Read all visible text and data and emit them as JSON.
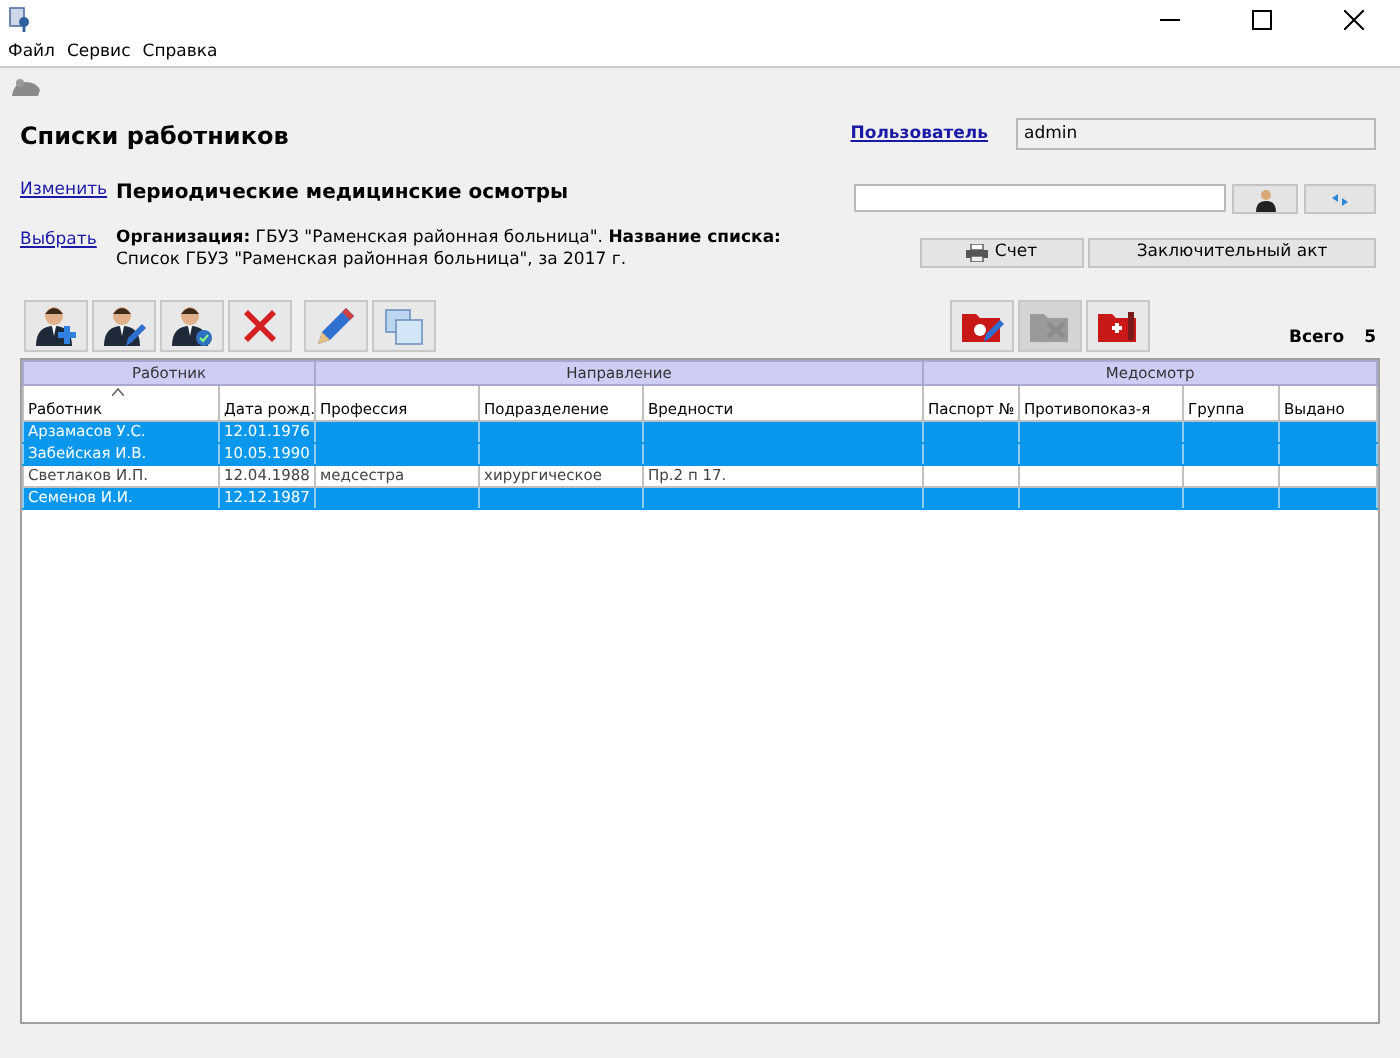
{
  "menu": [
    {
      "label": "Файл"
    },
    {
      "label": "Сервис"
    },
    {
      "label": "Справка"
    }
  ],
  "title": "Списки работников",
  "links": [
    {
      "label": "Изменить",
      "text": "Периодические медицинские осмотры",
      "kind": "heading"
    },
    {
      "label": "Выбрать",
      "text": "**Организация:** ГБУЗ \"Раменская районная больница\". **Название списка:** Список ГБУЗ \"Раменская районная больница\", за 2017 г.",
      "kind": "details"
    }
  ],
  "user": {
    "label": "Пользователь",
    "value": "admin"
  },
  "search": {
    "buttons": [
      {
        "kind": "person"
      },
      {
        "kind": "refresh"
      }
    ]
  },
  "actions": [
    {
      "label": "Счет",
      "kind": "printer"
    },
    {
      "label": "Заключительный акт",
      "kind": "plain"
    }
  ],
  "toolbar_left": [
    {
      "kind": "add-person",
      "disabled": false
    },
    {
      "kind": "edit-person",
      "disabled": false
    },
    {
      "kind": "check-person",
      "disabled": false
    },
    {
      "kind": "delete",
      "disabled": false
    },
    {
      "kind": "pencil",
      "disabled": false
    },
    {
      "kind": "copy",
      "disabled": false
    }
  ],
  "toolbar_right": [
    {
      "kind": "folder-pen",
      "disabled": false
    },
    {
      "kind": "folder-x",
      "disabled": true
    },
    {
      "kind": "folder-medical",
      "disabled": false
    }
  ],
  "total": {
    "label": "Всего",
    "value": "5"
  },
  "table": {
    "groups": [
      {
        "label": "Работник",
        "columns": [
          {
            "label": "Работник",
            "sorted": true
          },
          {
            "label": "Дата рожд.",
            "sorted": false
          }
        ]
      },
      {
        "label": "Направление",
        "columns": [
          {
            "label": "Профессия",
            "sorted": false
          },
          {
            "label": "Подразделение",
            "sorted": false
          },
          {
            "label": "Вредности",
            "sorted": false
          }
        ]
      },
      {
        "label": "Медосмотр",
        "columns": [
          {
            "label": "Паспорт №",
            "sorted": false
          },
          {
            "label": "Противопоказ-я",
            "sorted": false
          },
          {
            "label": "Группа",
            "sorted": false
          },
          {
            "label": "Выдано",
            "sorted": false
          }
        ]
      }
    ],
    "rows": [
      {
        "selected": true,
        "cells": [
          "Арзамасов У.С.",
          "12.01.1976",
          null,
          null,
          null,
          null,
          null,
          null,
          null
        ]
      },
      {
        "selected": true,
        "cells": [
          "Забейская И.В.",
          "10.05.1990",
          null,
          null,
          null,
          null,
          null,
          null,
          null
        ]
      },
      {
        "selected": false,
        "cells": [
          "Светлаков И.П.",
          "12.04.1988",
          "медсестра",
          "хирургическое",
          "Пр.2 п 17.",
          null,
          null,
          null,
          null
        ]
      },
      {
        "selected": true,
        "cells": [
          "Семенов И.И.",
          "12.12.1987",
          null,
          null,
          null,
          null,
          null,
          null,
          null
        ]
      }
    ]
  }
}
